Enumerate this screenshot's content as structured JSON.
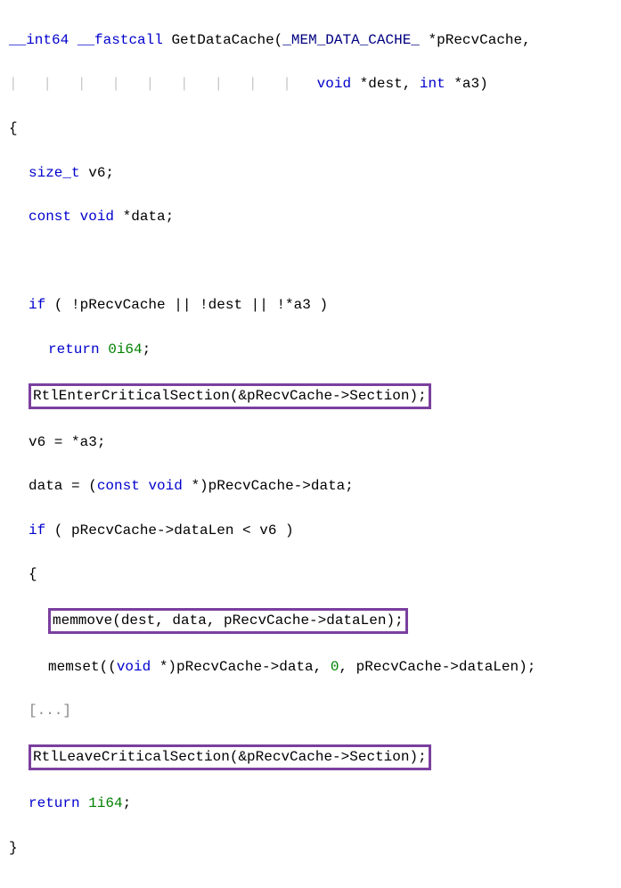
{
  "code": {
    "sig_part1": "__int64 __fastcall GetDataCache(_MEM_DATA_CACHE_ *pRecvCache,",
    "sig_pipes": "|   |   |   |   |   |   |   |   |   ",
    "sig_part2": "void *dest, int *a3)",
    "ret_type": "__int64",
    "callconv": "__fastcall",
    "fname": "GetDataCache",
    "ptype1": "_MEM_DATA_CACHE_",
    "pname1": "*pRecvCache",
    "ptype2": "void",
    "pstar2": "*dest",
    "ptype3": "int",
    "pstar3": "*a3",
    "open_brace": "{",
    "decl1_type": "size_t",
    "decl1_name": "v6",
    "decl1_semi": ";",
    "decl2_kw1": "const",
    "decl2_kw2": "void",
    "decl2_name": "*data",
    "decl2_semi": ";",
    "if_kw": "if",
    "if_cond": " ( !pRecvCache || !dest || !*a3 )",
    "ret_kw": "return",
    "ret_lit": "0i64",
    "ret_semi": ";",
    "enter_crit": "RtlEnterCriticalSection(&pRecvCache->Section);",
    "v6_assign": "v6 = *a3;",
    "data_assign_pre": "data = (",
    "data_assign_kw1": "const",
    "data_assign_kw2": "void",
    "data_assign_post": " *)pRecvCache->data;",
    "if2_kw": "if",
    "if2_cond": " ( pRecvCache->dataLen < v6 )",
    "open_brace2": "{",
    "memmove_line": "memmove(dest, data, pRecvCache->dataLen);",
    "memset_pre": "memset((",
    "memset_kw": "void",
    "memset_mid": " *)pRecvCache->data, ",
    "memset_lit": "0",
    "memset_post": ", pRecvCache->dataLen);",
    "ellipsis": "[...]",
    "leave_crit": "RtlLeaveCriticalSection(&pRecvCache->Section);",
    "ret2_kw": "return",
    "ret2_lit": "1i64",
    "ret2_semi": ";",
    "close_brace": "}"
  }
}
